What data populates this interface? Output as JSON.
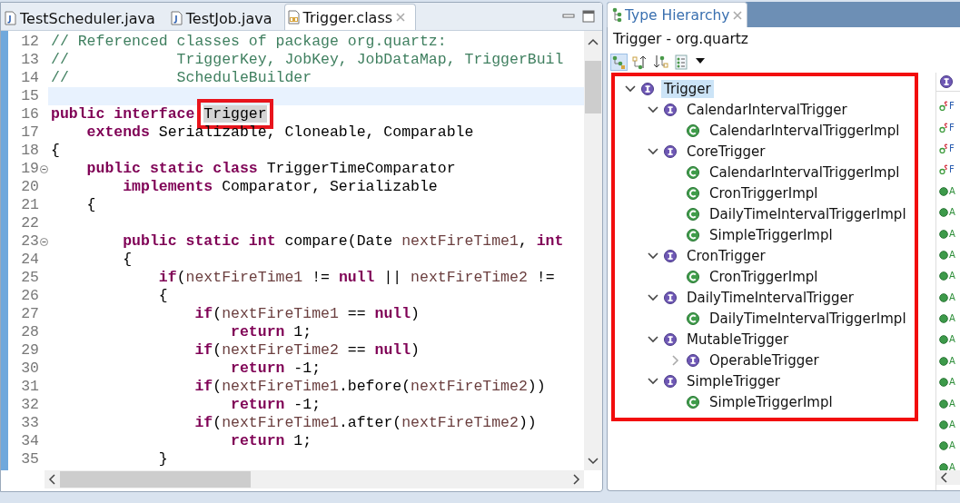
{
  "editor": {
    "tabs": [
      {
        "label": "TestScheduler.java",
        "kind": "java",
        "selected": false
      },
      {
        "label": "TestJob.java",
        "kind": "java",
        "selected": false
      },
      {
        "label": "Trigger.class",
        "kind": "class",
        "selected": true
      }
    ],
    "lines": [
      {
        "number": "12",
        "tokens": [
          {
            "kind": "comment",
            "text": "// Referenced classes of package org.quartz:"
          }
        ]
      },
      {
        "number": "13",
        "tokens": [
          {
            "kind": "comment",
            "text": "//            TriggerKey, JobKey, JobDataMap, TriggerBuil"
          }
        ]
      },
      {
        "number": "14",
        "tokens": [
          {
            "kind": "comment",
            "text": "//            ScheduleBuilder"
          }
        ]
      },
      {
        "number": "15",
        "current": true
      },
      {
        "number": "16",
        "tokens": [
          {
            "kind": "keyword",
            "text": "public interface "
          },
          {
            "kind": "plain",
            "text": "Trigger",
            "highlighted": true
          }
        ]
      },
      {
        "number": "17",
        "tokens": [
          {
            "kind": "keyword",
            "text": "    extends"
          },
          {
            "kind": "plain",
            "text": " Serializable, Cloneable, Comparable"
          }
        ]
      },
      {
        "number": "18",
        "tokens": [
          {
            "kind": "plain",
            "text": "{"
          }
        ]
      },
      {
        "number": "19",
        "fold": true,
        "tokens": [
          {
            "kind": "keyword",
            "text": "    public static class"
          },
          {
            "kind": "plain",
            "text": " TriggerTimeComparator"
          }
        ]
      },
      {
        "number": "20",
        "tokens": [
          {
            "kind": "keyword",
            "text": "        implements"
          },
          {
            "kind": "plain",
            "text": " Comparator, Serializable"
          }
        ]
      },
      {
        "number": "21",
        "tokens": [
          {
            "kind": "plain",
            "text": "    {"
          }
        ]
      },
      {
        "number": "22"
      },
      {
        "number": "23",
        "fold": true,
        "tokens": [
          {
            "kind": "keyword",
            "text": "        public static int"
          },
          {
            "kind": "plain",
            "text": " compare(Date "
          },
          {
            "kind": "param",
            "text": "nextFireTime1"
          },
          {
            "kind": "plain",
            "text": ", "
          },
          {
            "kind": "keyword",
            "text": "int"
          }
        ]
      },
      {
        "number": "24",
        "tokens": [
          {
            "kind": "plain",
            "text": "        {"
          }
        ]
      },
      {
        "number": "25",
        "tokens": [
          {
            "kind": "keyword",
            "text": "            if"
          },
          {
            "kind": "plain",
            "text": "("
          },
          {
            "kind": "param",
            "text": "nextFireTime1"
          },
          {
            "kind": "plain",
            "text": " != "
          },
          {
            "kind": "keyword",
            "text": "null"
          },
          {
            "kind": "plain",
            "text": " || "
          },
          {
            "kind": "param",
            "text": "nextFireTime2"
          },
          {
            "kind": "plain",
            "text": " !="
          }
        ]
      },
      {
        "number": "26",
        "tokens": [
          {
            "kind": "plain",
            "text": "            {"
          }
        ]
      },
      {
        "number": "27",
        "tokens": [
          {
            "kind": "keyword",
            "text": "                if"
          },
          {
            "kind": "plain",
            "text": "("
          },
          {
            "kind": "param",
            "text": "nextFireTime1"
          },
          {
            "kind": "plain",
            "text": " == "
          },
          {
            "kind": "keyword",
            "text": "null"
          },
          {
            "kind": "plain",
            "text": ")"
          }
        ]
      },
      {
        "number": "28",
        "tokens": [
          {
            "kind": "keyword",
            "text": "                    return"
          },
          {
            "kind": "plain",
            "text": " 1;"
          }
        ]
      },
      {
        "number": "29",
        "tokens": [
          {
            "kind": "keyword",
            "text": "                if"
          },
          {
            "kind": "plain",
            "text": "("
          },
          {
            "kind": "param",
            "text": "nextFireTime2"
          },
          {
            "kind": "plain",
            "text": " == "
          },
          {
            "kind": "keyword",
            "text": "null"
          },
          {
            "kind": "plain",
            "text": ")"
          }
        ]
      },
      {
        "number": "30",
        "tokens": [
          {
            "kind": "keyword",
            "text": "                    return"
          },
          {
            "kind": "plain",
            "text": " -1;"
          }
        ]
      },
      {
        "number": "31",
        "tokens": [
          {
            "kind": "keyword",
            "text": "                if"
          },
          {
            "kind": "plain",
            "text": "("
          },
          {
            "kind": "param",
            "text": "nextFireTime1"
          },
          {
            "kind": "plain",
            "text": ".before("
          },
          {
            "kind": "param",
            "text": "nextFireTime2"
          },
          {
            "kind": "plain",
            "text": "))"
          }
        ]
      },
      {
        "number": "32",
        "tokens": [
          {
            "kind": "keyword",
            "text": "                    return"
          },
          {
            "kind": "plain",
            "text": " -1;"
          }
        ]
      },
      {
        "number": "33",
        "tokens": [
          {
            "kind": "keyword",
            "text": "                if"
          },
          {
            "kind": "plain",
            "text": "("
          },
          {
            "kind": "param",
            "text": "nextFireTime1"
          },
          {
            "kind": "plain",
            "text": ".after("
          },
          {
            "kind": "param",
            "text": "nextFireTime2"
          },
          {
            "kind": "plain",
            "text": "))"
          }
        ]
      },
      {
        "number": "34",
        "tokens": [
          {
            "kind": "keyword",
            "text": "                    return"
          },
          {
            "kind": "plain",
            "text": " 1;"
          }
        ]
      },
      {
        "number": "35",
        "tokens": [
          {
            "kind": "plain",
            "text": "            }"
          }
        ]
      }
    ]
  },
  "hierarchy": {
    "tab": {
      "label": "Type Hierarchy",
      "selected": true
    },
    "title": "Trigger - org.quartz",
    "tree_highlighted": true,
    "tree": [
      {
        "label": "Trigger",
        "kind": "interface",
        "expanded": true,
        "selected": true,
        "children": [
          {
            "label": "CalendarIntervalTrigger",
            "kind": "interface",
            "expanded": true,
            "selected": false,
            "children": [
              {
                "label": "CalendarIntervalTriggerImpl",
                "kind": "class",
                "selected": false
              }
            ]
          },
          {
            "label": "CoreTrigger",
            "kind": "interface",
            "expanded": true,
            "selected": false,
            "children": [
              {
                "label": "CalendarIntervalTriggerImpl",
                "kind": "class",
                "selected": false
              },
              {
                "label": "CronTriggerImpl",
                "kind": "class",
                "selected": false
              },
              {
                "label": "DailyTimeIntervalTriggerImpl",
                "kind": "class",
                "selected": false
              },
              {
                "label": "SimpleTriggerImpl",
                "kind": "class",
                "selected": false
              }
            ]
          },
          {
            "label": "CronTrigger",
            "kind": "interface",
            "expanded": true,
            "selected": false,
            "children": [
              {
                "label": "CronTriggerImpl",
                "kind": "class",
                "selected": false
              }
            ]
          },
          {
            "label": "DailyTimeIntervalTrigger",
            "kind": "interface",
            "expanded": true,
            "selected": false,
            "children": [
              {
                "label": "DailyTimeIntervalTriggerImpl",
                "kind": "class",
                "selected": false
              }
            ]
          },
          {
            "label": "MutableTrigger",
            "kind": "interface",
            "expanded": true,
            "selected": false,
            "children": [
              {
                "label": "OperableTrigger",
                "kind": "interface",
                "expanded": false,
                "selected": false
              }
            ]
          },
          {
            "label": "SimpleTrigger",
            "kind": "interface",
            "expanded": true,
            "selected": false,
            "children": [
              {
                "label": "SimpleTriggerImpl",
                "kind": "class",
                "selected": false
              }
            ]
          }
        ]
      }
    ],
    "members": [
      {
        "kind": "static-field",
        "label": "F"
      },
      {
        "kind": "static-field",
        "label": "F"
      },
      {
        "kind": "static-field",
        "label": "F"
      },
      {
        "kind": "static-field",
        "label": "F"
      },
      {
        "kind": "method",
        "label": "A"
      },
      {
        "kind": "method",
        "label": "A"
      },
      {
        "kind": "method",
        "label": "A"
      },
      {
        "kind": "method",
        "label": "A"
      },
      {
        "kind": "method",
        "label": "A"
      },
      {
        "kind": "method",
        "label": "A"
      },
      {
        "kind": "method",
        "label": "A"
      },
      {
        "kind": "method",
        "label": "A"
      },
      {
        "kind": "method",
        "label": "A"
      },
      {
        "kind": "method",
        "label": "A"
      },
      {
        "kind": "method",
        "label": "A"
      },
      {
        "kind": "method",
        "label": "A"
      },
      {
        "kind": "method",
        "label": "A"
      },
      {
        "kind": "method",
        "label": "A"
      }
    ]
  }
}
